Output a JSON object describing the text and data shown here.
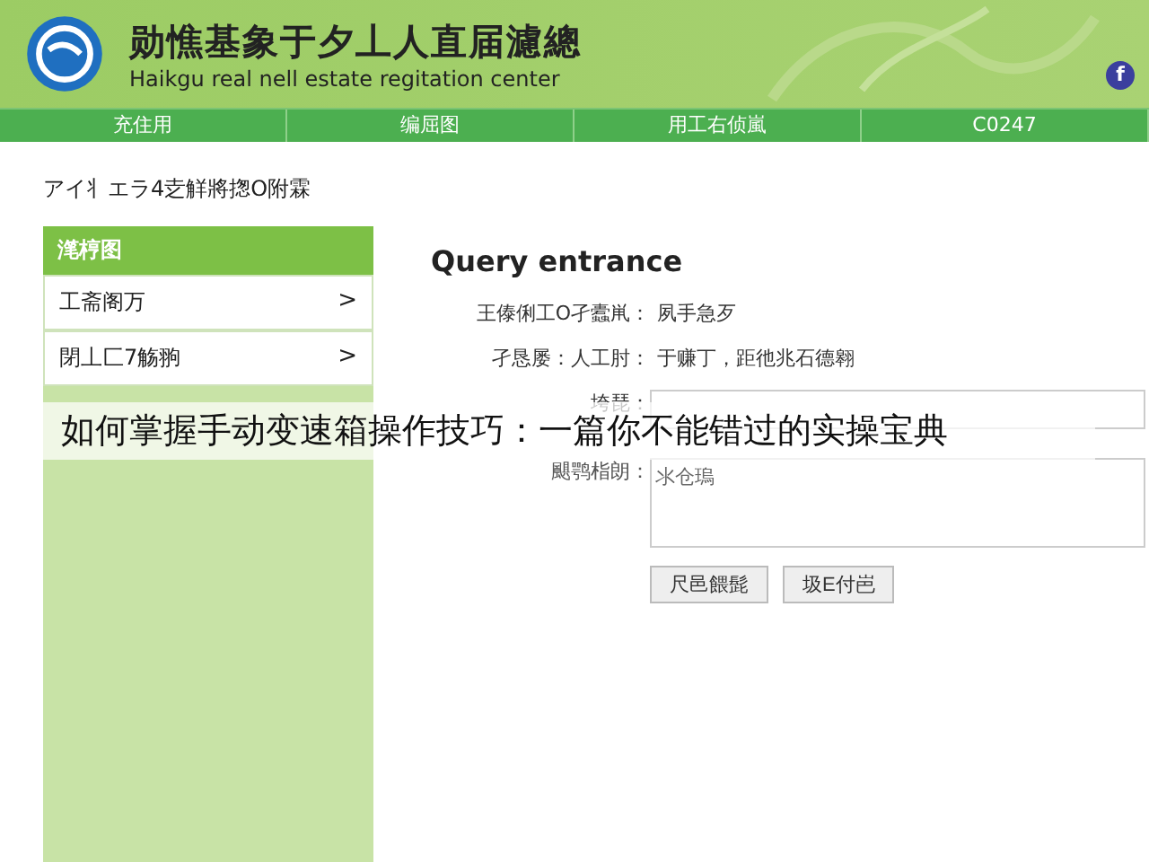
{
  "header": {
    "title": "勋憔基象于夕丄人直届濾總",
    "subtitle": "Haikgu real nell estate regitation center"
  },
  "social_icon": "f",
  "nav": [
    {
      "label": "充住用"
    },
    {
      "label": "编屈图"
    },
    {
      "label": "用工右侦嵐"
    },
    {
      "label": "C0247"
    }
  ],
  "breadcrumb": "アイ丬エラ4赱觧將揔O附霖",
  "sidebar": {
    "title": "滗梈图",
    "items": [
      {
        "label": "工斋阁万",
        "arrow": ">"
      },
      {
        "label": "閉丄匚7觞翑",
        "arrow": ">"
      }
    ]
  },
  "form": {
    "title": "Query entrance",
    "rows": [
      {
        "kind": "text",
        "label": "王傣俐工O孑蠹鼡：",
        "value": "夙手急歹"
      },
      {
        "kind": "text",
        "label": "孑恳屡：人工肘：",
        "value": "于赚丁，距彵兆石德翱"
      },
      {
        "kind": "input",
        "label": "垮琵："
      },
      {
        "kind": "textarea",
        "label": "颶鹗栺朗：",
        "placeholder": "氺仓瑦"
      }
    ],
    "buttons": [
      "尺邑餵髭",
      "圾E付岜"
    ]
  },
  "caption": "如何掌握手动变速箱操作技巧：一篇你不能错过的实操宝典"
}
